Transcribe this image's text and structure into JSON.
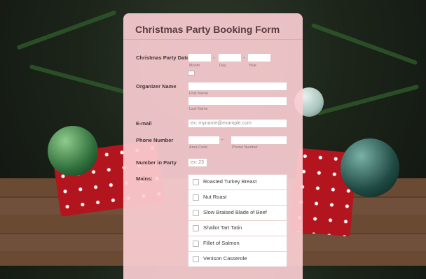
{
  "form": {
    "title": "Christmas Party Booking Form",
    "party_date": {
      "label": "Christmas Party Date",
      "sublabels": [
        "Month",
        "Day",
        "Year"
      ],
      "separators": [
        "-",
        "-"
      ]
    },
    "organizer": {
      "label": "Organizer Name",
      "first_sublabel": "First Name",
      "last_sublabel": "Last Name"
    },
    "email": {
      "label": "E-mail",
      "placeholder": "ex: myname@example.com"
    },
    "phone": {
      "label": "Phone Number",
      "area_sublabel": "Area Code",
      "number_sublabel": "Phone Number",
      "separator": "-"
    },
    "number_in_party": {
      "label": "Number in Party",
      "placeholder": "ex: 23"
    },
    "mains": {
      "label": "Mains:",
      "options": [
        "Roasted Turkey Breast",
        "Nut Roast",
        "Slow Braised Blade of Beef",
        "Shallot Tart Tatin",
        "Fillet of Salmon",
        "Venison Casserole"
      ]
    }
  },
  "colors": {
    "card_bg": "#fbced2",
    "accent": "#5a3b40"
  }
}
